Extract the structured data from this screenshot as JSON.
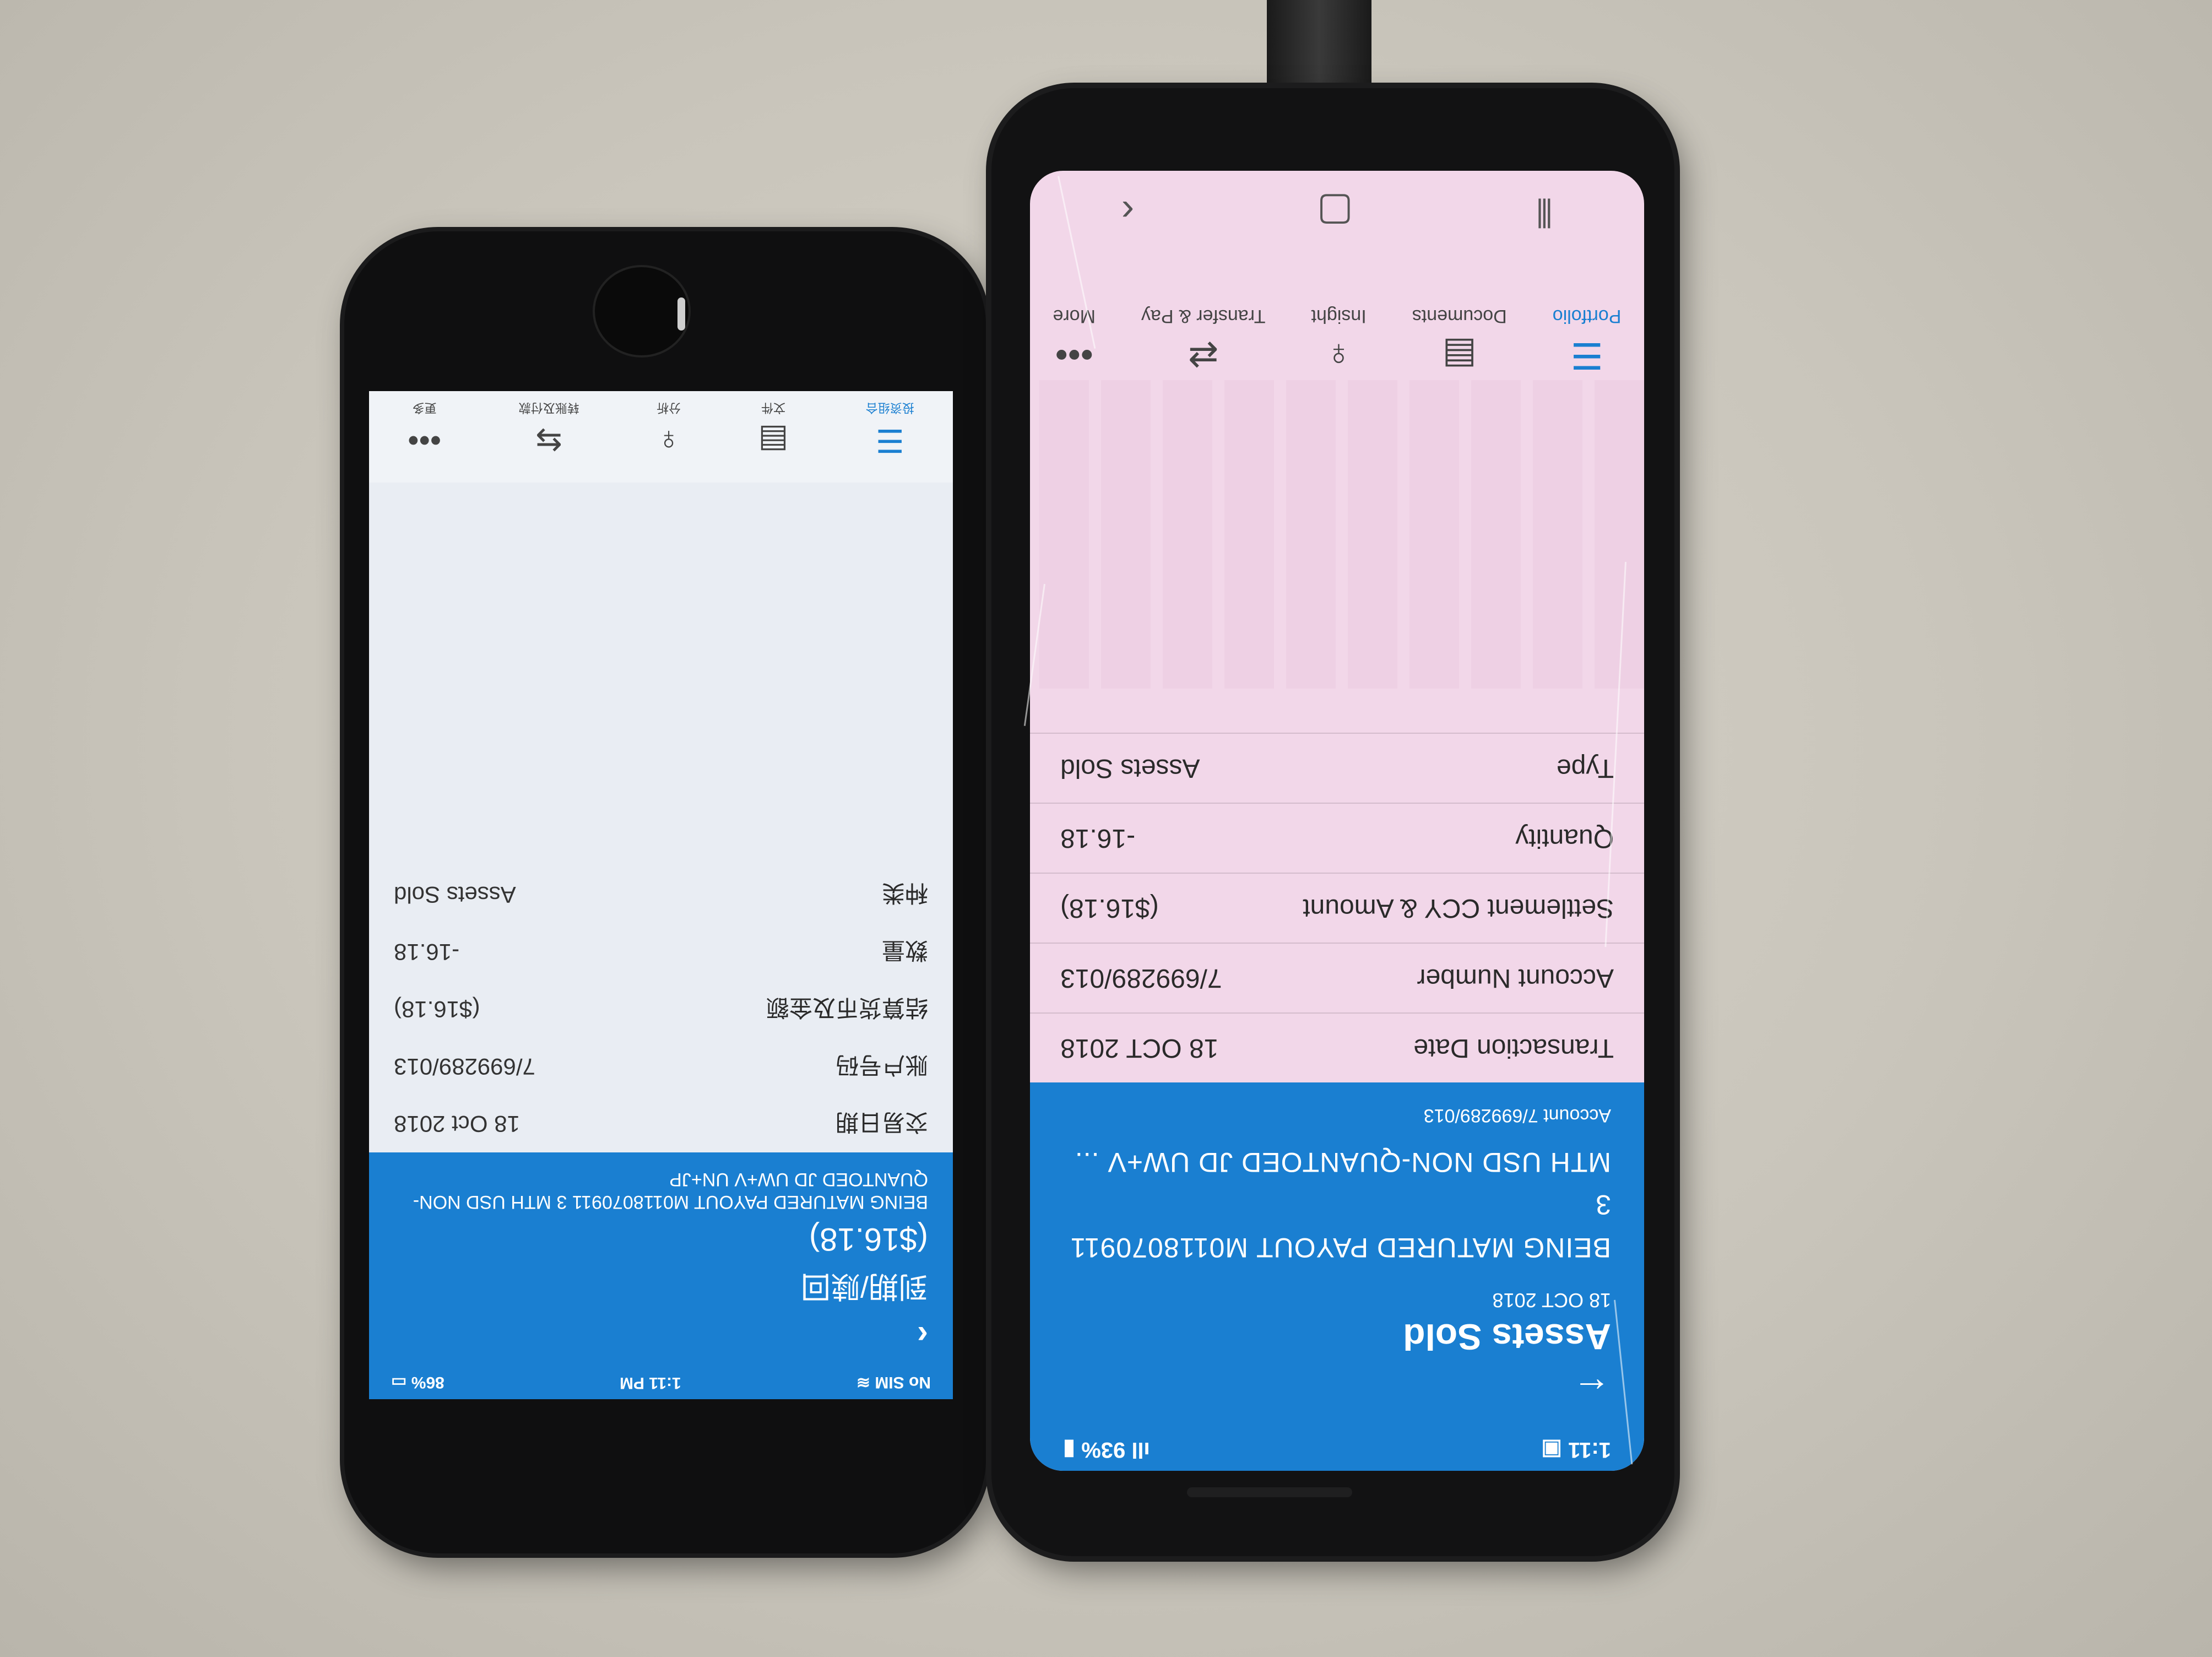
{
  "left_phone": {
    "status": {
      "carrier": "No SIM",
      "time": "1:11 PM",
      "battery": "86%"
    },
    "header": {
      "title": "到期/赎回",
      "amount": "($16.18)",
      "description": "BEING MATURED PAYOUT M0118070911  3 MTH USD NON-QUANTOED JD UW+V UN+JP"
    },
    "details": [
      {
        "label": "交易日期",
        "value": "18 Oct 2018"
      },
      {
        "label": "账户号码",
        "value": "7/699289/013"
      },
      {
        "label": "结算货币及金额",
        "value": "($16.18)"
      },
      {
        "label": "数量",
        "value": "-16.18"
      },
      {
        "label": "种类",
        "value": "Assets Sold"
      }
    ],
    "tabs": [
      {
        "label": "投资组合",
        "icon": "database-icon"
      },
      {
        "label": "文件",
        "icon": "document-icon"
      },
      {
        "label": "分析",
        "icon": "lightbulb-icon"
      },
      {
        "label": "转账及付款",
        "icon": "transfer-icon"
      },
      {
        "label": "更多",
        "icon": "more-icon"
      }
    ]
  },
  "right_phone": {
    "status": {
      "time": "1:11",
      "battery": "93%"
    },
    "header": {
      "title": "Assets Sold",
      "date": "18 OCT 2018",
      "description_line1": "BEING MATURED PAYOUT M0118070911",
      "description_line2": "3",
      "description_line3": "MTH USD NON-QUANTOED JD UW+V ...",
      "account": "Account 7/699289/013"
    },
    "details": [
      {
        "label": "Transaction Date",
        "value": "18 OCT 2018"
      },
      {
        "label": "Account Number",
        "value": "7/699289/013"
      },
      {
        "label": "Settlement CCY & Amount",
        "value": "($16.18)"
      },
      {
        "label": "Quantity",
        "value": "-16.18"
      },
      {
        "label": "Type",
        "value": "Assets Sold"
      }
    ],
    "tabs": [
      {
        "label": "Portfolio",
        "icon": "database-icon"
      },
      {
        "label": "Documents",
        "icon": "document-icon"
      },
      {
        "label": "Insight",
        "icon": "lightbulb-icon"
      },
      {
        "label": "Transfer & Pay",
        "icon": "transfer-icon"
      },
      {
        "label": "More",
        "icon": "more-icon"
      }
    ]
  },
  "colors": {
    "accent": "#1a7fd1",
    "left_screen_bg": "#e9edf3",
    "right_screen_bg": "#f2d7e9"
  }
}
